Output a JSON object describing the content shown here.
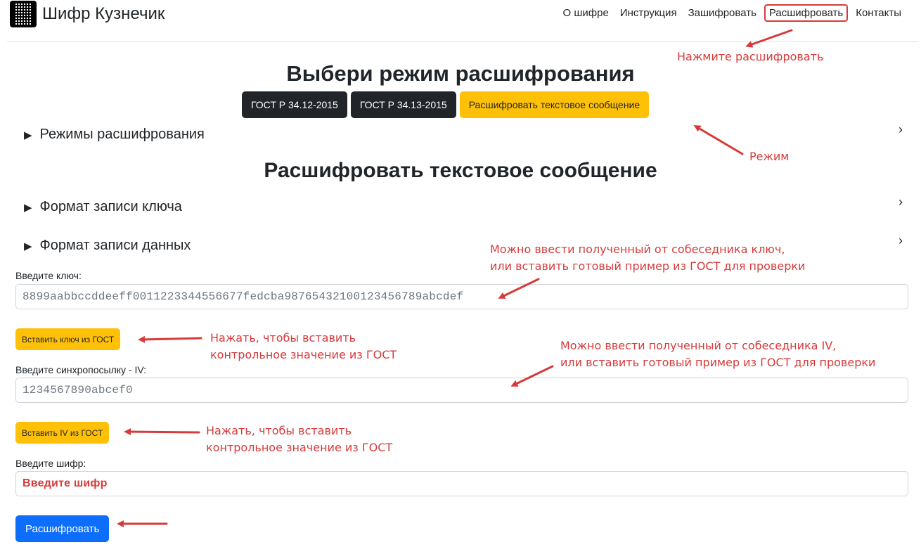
{
  "header": {
    "brand": "Шифр Кузнечик",
    "nav": [
      "О шифре",
      "Инструкция",
      "Зашифровать",
      "Расшифровать",
      "Контакты"
    ]
  },
  "mode_section": {
    "title": "Выбери режим расшифрования",
    "buttons": [
      "ГОСТ Р 34.12-2015",
      "ГОСТ Р 34.13-2015",
      "Расшифровать текстовое сообщение"
    ],
    "details_label": "Режимы расшифрования"
  },
  "message_section": {
    "title": "Расшифровать текстовое сообщение",
    "key_format": "Формат записи ключа",
    "data_format": "Формат записи данных"
  },
  "form": {
    "key_label": "Введите ключ:",
    "key_value": "8899aabbccddeeff0011223344556677fedcba98765432100123456789abcdef",
    "key_button": "Вставить ключ из ГОСТ",
    "iv_label": "Введите синхропосылку - IV:",
    "iv_value": "1234567890abcef0",
    "iv_button": "Вставить IV из ГОСТ",
    "cipher_label": "Введите шифр:",
    "cipher_placeholder": "Введите шифр",
    "submit": "Расшифровать"
  },
  "annotations": {
    "click_decrypt": "Нажмите расшифровать",
    "mode": "Режим",
    "key_hint_1": "Можно ввести полученный от собеседника ключ,",
    "key_hint_2": "или вставить готовый пример из ГОСТ для проверки",
    "key_btn_hint_1": "Нажать, чтобы вставить",
    "key_btn_hint_2": "контрольное значение из ГОСТ",
    "iv_hint_1": "Можно ввести полученный от собеседника IV,",
    "iv_hint_2": "или вставить готовый пример из ГОСТ для проверки",
    "iv_btn_hint_1": "Нажать, чтобы вставить",
    "iv_btn_hint_2": "контрольное значение из ГОСТ"
  },
  "colors": {
    "accent_red": "#d73a3a",
    "warning_yellow": "#ffc107",
    "primary_blue": "#0d6efd",
    "dark": "#212529"
  }
}
